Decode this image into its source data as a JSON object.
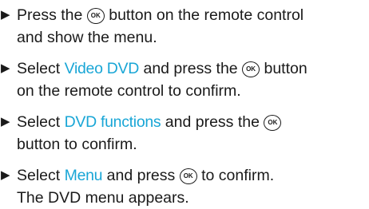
{
  "ok_symbol": "OK",
  "bullet": "▶",
  "steps": [
    {
      "line1": {
        "a": "Press the",
        "b": "button on the remote control"
      },
      "line2": "and show the menu."
    },
    {
      "line1": {
        "a": "Select",
        "term": "Video DVD",
        "b": "and press the",
        "c": "button"
      },
      "line2": "on the remote control to confirm."
    },
    {
      "line1": {
        "a": "Select",
        "term": "DVD functions",
        "b": "and press the"
      },
      "line2": "button to confirm."
    },
    {
      "line1": {
        "a": "Select",
        "term": "Menu",
        "b": "and press",
        "c": "to confirm."
      },
      "line2": "The DVD menu appears."
    }
  ]
}
